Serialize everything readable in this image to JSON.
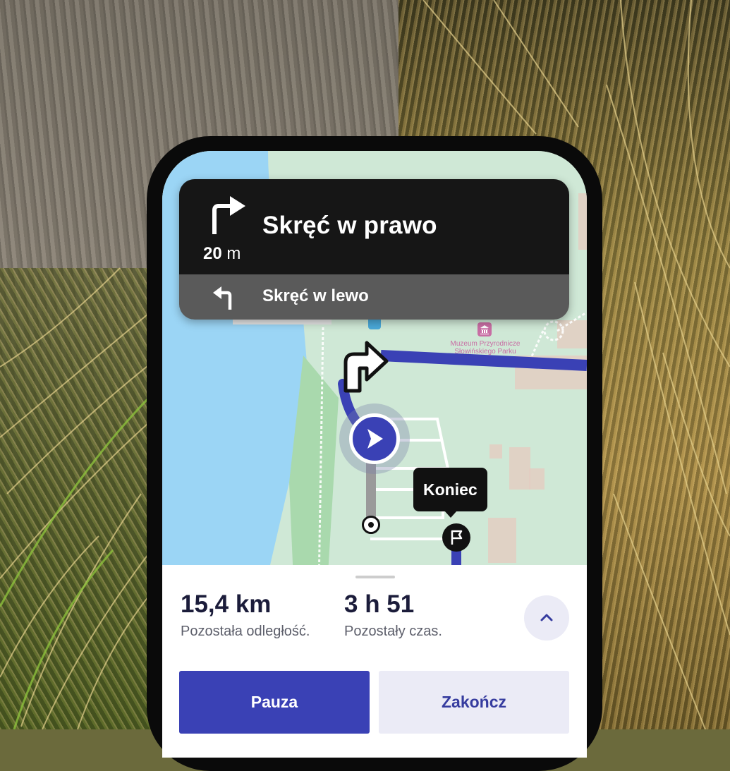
{
  "navigation": {
    "current_instruction": "Skręć w prawo",
    "distance_value": "20",
    "distance_unit": "m",
    "next_instruction": "Skręć w lewo",
    "current_icon": "turn-right-icon",
    "next_icon": "turn-left-icon"
  },
  "map": {
    "poi_label": "Muzeum Przyrodnicze Słowińskiego Parku",
    "destination_tooltip": "Koniec",
    "route_color": "#3a41b5",
    "water_color": "#9bd5f5",
    "land_color": "#cfe8d6",
    "icons": [
      "position-arrow-icon",
      "flag-icon",
      "start-point-icon",
      "museum-icon",
      "info-icon"
    ]
  },
  "trip": {
    "remaining_distance": "15,4 km",
    "remaining_distance_label": "Pozostała odległość.",
    "remaining_time": "3 h 51",
    "remaining_time_label": "Pozostały czas.",
    "expand_icon": "chevron-up-icon"
  },
  "actions": {
    "pause_label": "Pauza",
    "end_label": "Zakończ"
  },
  "colors": {
    "accent": "#3a41b5",
    "accent_light": "#ebebf6",
    "card_dark": "#161616",
    "card_secondary": "#5a5a5a"
  }
}
